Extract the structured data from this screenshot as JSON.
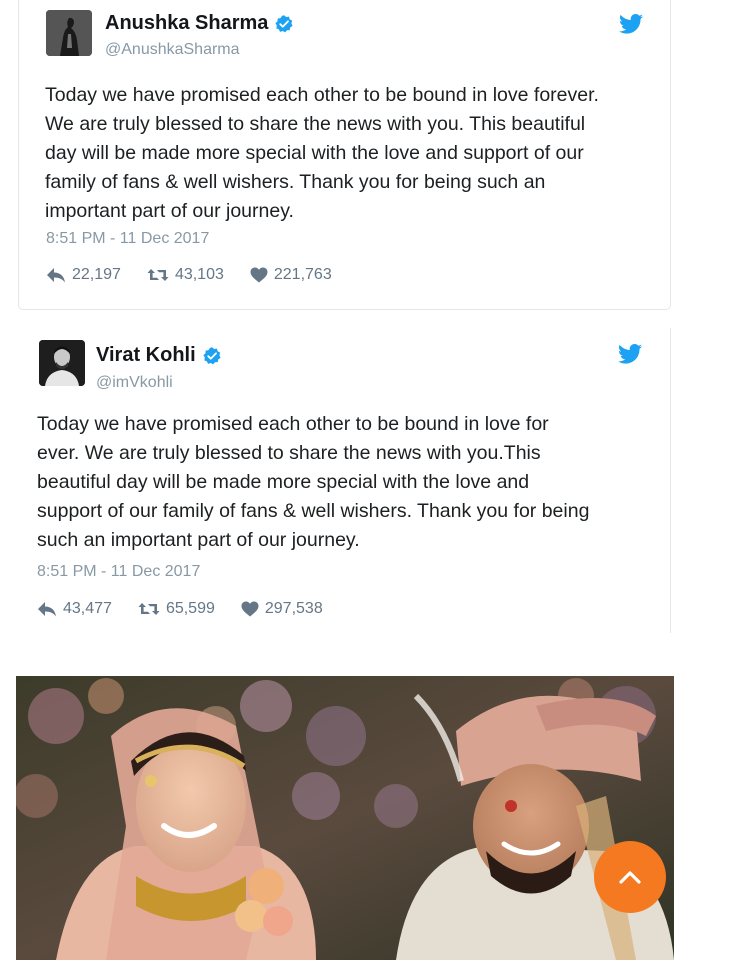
{
  "tweets": [
    {
      "display_name": "Anushka Sharma",
      "handle": "@AnushkaSharma",
      "text": "Today we have promised each other to be bound in love forever.\nWe are truly blessed to share the news with you. This beautiful\nday will be made more special with the love and support of our\nfamily of fans & well wishers. Thank you for being such an\nimportant part of our journey.",
      "timestamp": "8:51 PM - 11 Dec 2017",
      "replies": "22,197",
      "retweets": "43,103",
      "likes": "221,763"
    },
    {
      "display_name": "Virat Kohli",
      "handle": "@imVkohli",
      "text": "Today we have promised each other to be bound in love for\never. We are truly blessed to share the news with you.This\nbeautiful day will be made more special with the love and\nsupport of our family of fans & well wishers. Thank you for being\nsuch an important part of our journey.",
      "timestamp": "8:51 PM - 11 Dec 2017",
      "replies": "43,477",
      "retweets": "65,599",
      "likes": "297,538"
    }
  ],
  "icons": {
    "verified": "verified-badge-icon",
    "bird": "twitter-bird-icon",
    "reply": "reply-icon",
    "retweet": "retweet-icon",
    "like": "heart-icon",
    "scroll_top": "chevron-up-icon"
  },
  "colors": {
    "twitter_blue": "#1da1f2",
    "scroll_button": "#f47920"
  }
}
